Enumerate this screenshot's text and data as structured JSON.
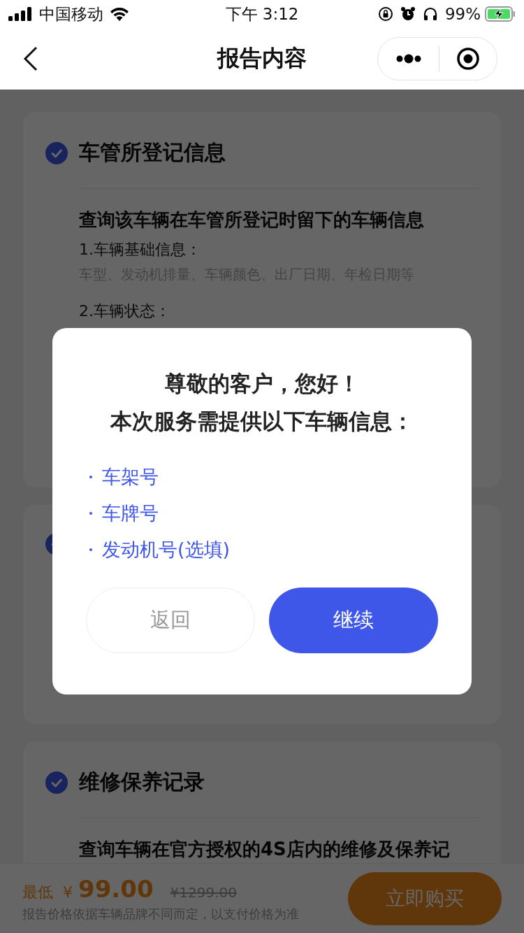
{
  "status_bar": {
    "carrier": "中国移动",
    "time": "下午 3:12",
    "battery": "99%",
    "charging": true
  },
  "nav": {
    "title": "报告内容"
  },
  "sections": [
    {
      "title": "车管所登记信息",
      "checked": true,
      "description": "查询该车辆在车管所登记时留下的车辆信息",
      "items": [
        {
          "label": "1.车辆基础信息：",
          "detail": "车型、发动机排量、车辆颜色、出厂日期、年检日期等"
        },
        {
          "label": "2.车辆状态："
        }
      ]
    },
    {
      "checked": true
    },
    {
      "title": "维修保养记录",
      "checked": true,
      "description": "查询车辆在官方授权的4S店内的维修及保养记"
    }
  ],
  "purchase_bar": {
    "price_label": "最低",
    "currency": "¥",
    "price": "99.00",
    "original_price": "¥1299.00",
    "note": "报告价格依据车辆品牌不同而定，以支付价格为准",
    "buy_button": "立即购买"
  },
  "dialog": {
    "title_lines": [
      "尊敬的客户，您好！",
      "本次服务需提供以下车辆信息："
    ],
    "items": [
      "车架号",
      "车牌号",
      "发动机号(选填)"
    ],
    "buttons": [
      {
        "label": "返回",
        "kind": "secondary"
      },
      {
        "label": "继续",
        "kind": "primary"
      }
    ]
  }
}
